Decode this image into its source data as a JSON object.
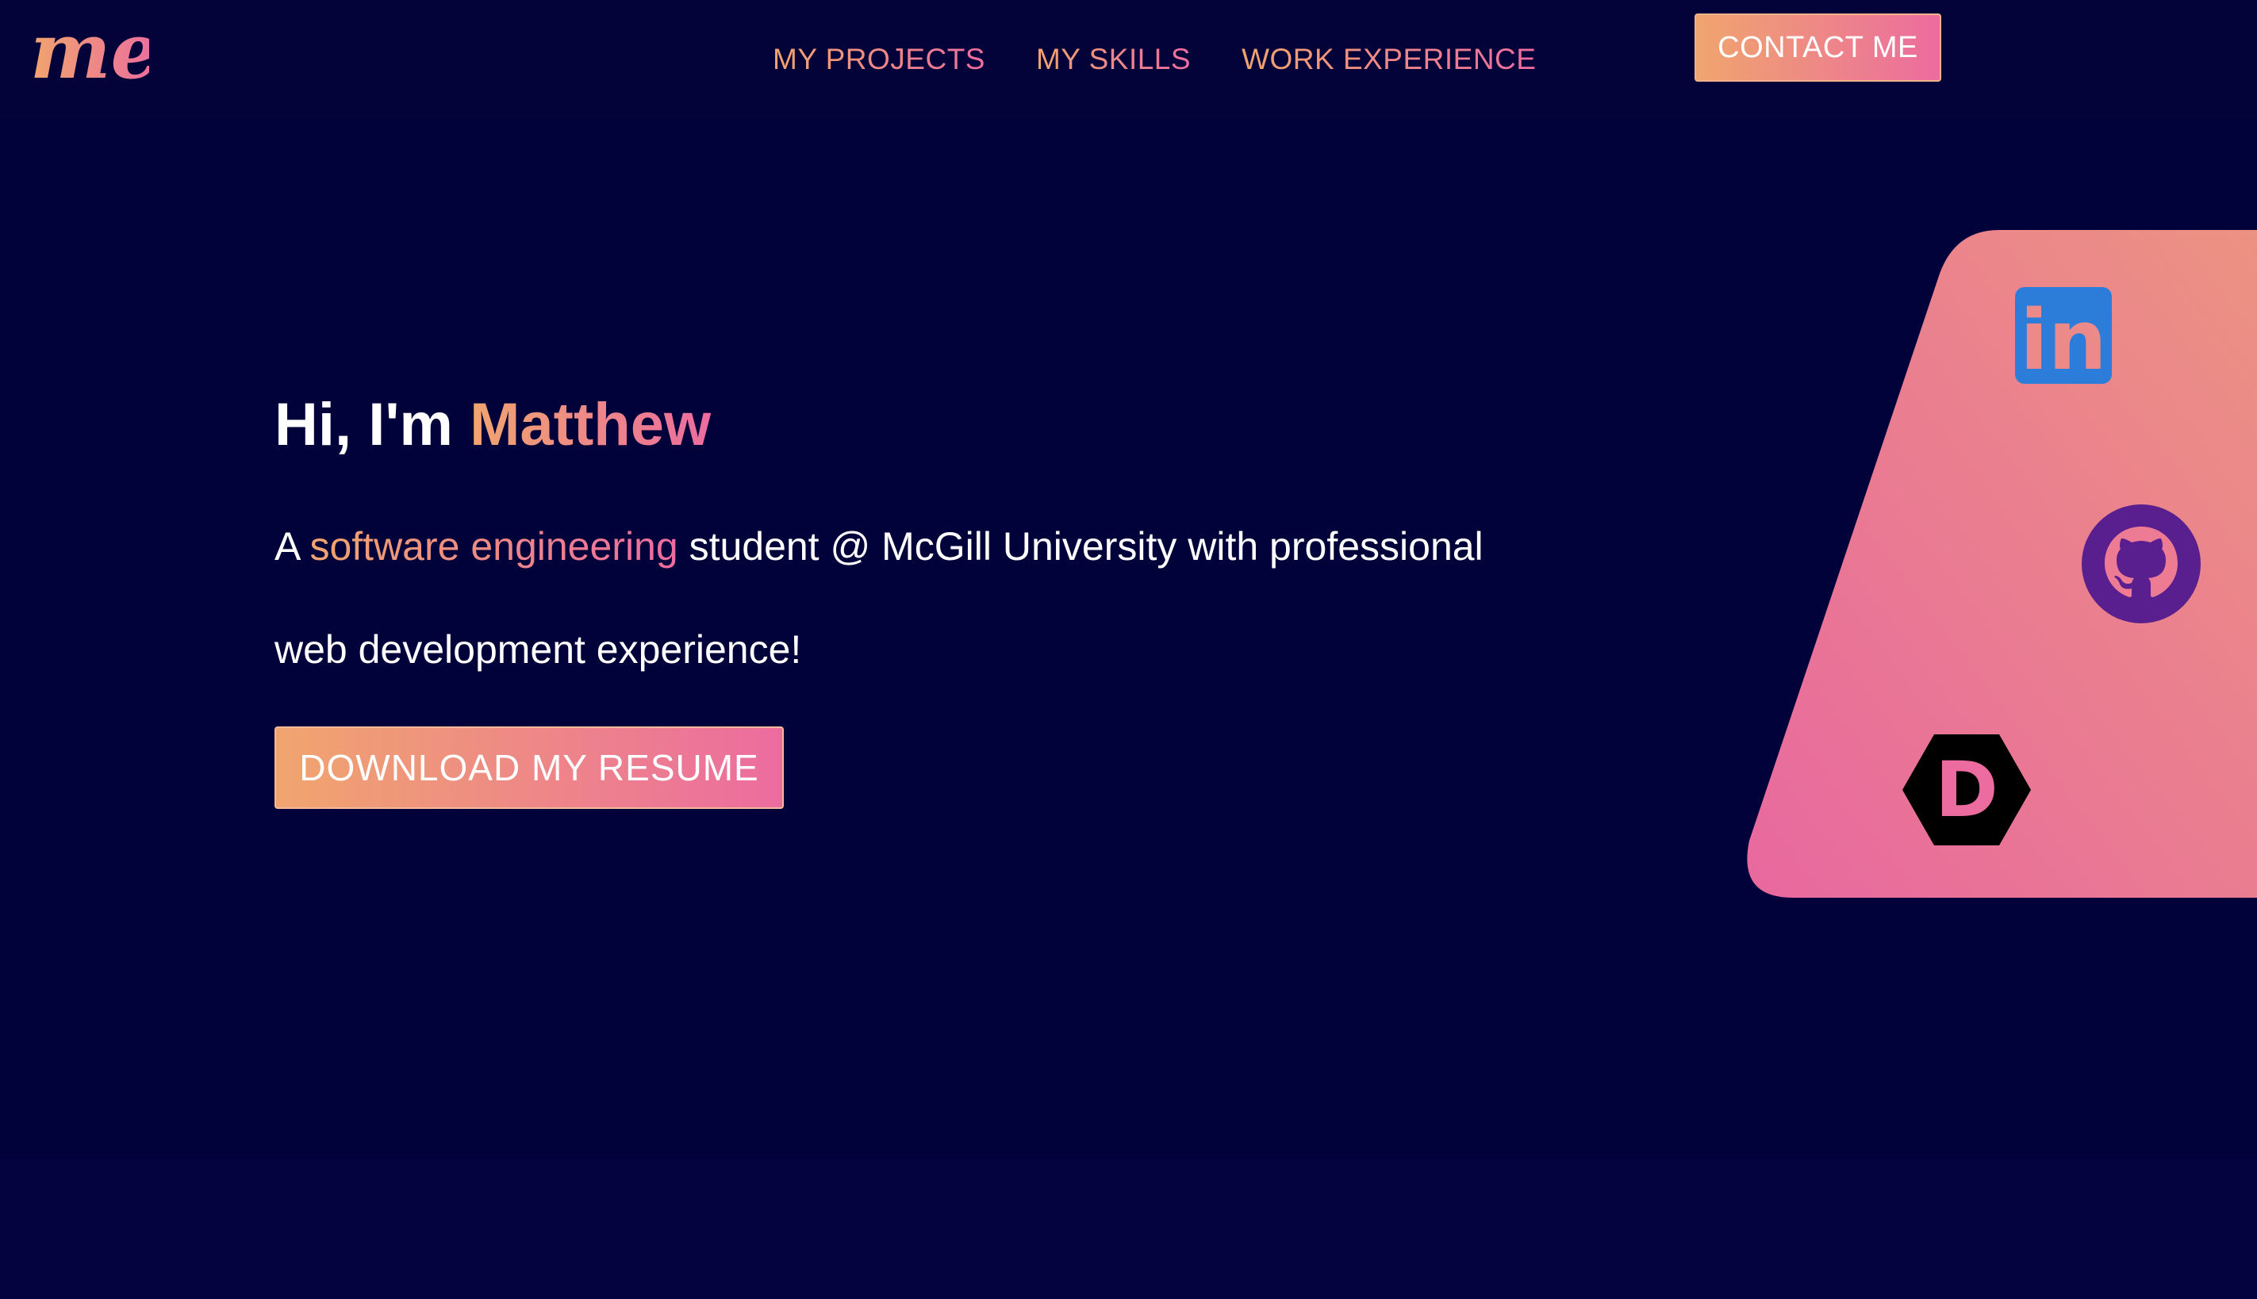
{
  "logo": {
    "text": "me",
    "icon": "me-script-logo"
  },
  "nav": {
    "items": [
      {
        "label": "MY PROJECTS"
      },
      {
        "label": "MY SKILLS"
      },
      {
        "label": "WORK EXPERIENCE"
      }
    ],
    "contact_label": "CONTACT ME"
  },
  "hero": {
    "greeting": "Hi, I'm ",
    "name": "Matthew",
    "line1_prefix": "A ",
    "line1_highlight": "software engineering",
    "line1_suffix": " student @ McGill University with professional",
    "line2": "web development experience!",
    "resume_label": "DOWNLOAD MY RESUME"
  },
  "social": {
    "linkedin": {
      "icon": "linkedin-icon",
      "glyph": "in"
    },
    "github": {
      "icon": "github-icon"
    },
    "devto": {
      "icon": "devto-icon",
      "glyph": "D"
    }
  },
  "colors": {
    "background": "#02023a",
    "gradient_start": "#f0a56e",
    "gradient_end": "#ec6c9f",
    "linkedin_blue": "#2c7cd9",
    "github_purple": "#5a1f8f"
  }
}
